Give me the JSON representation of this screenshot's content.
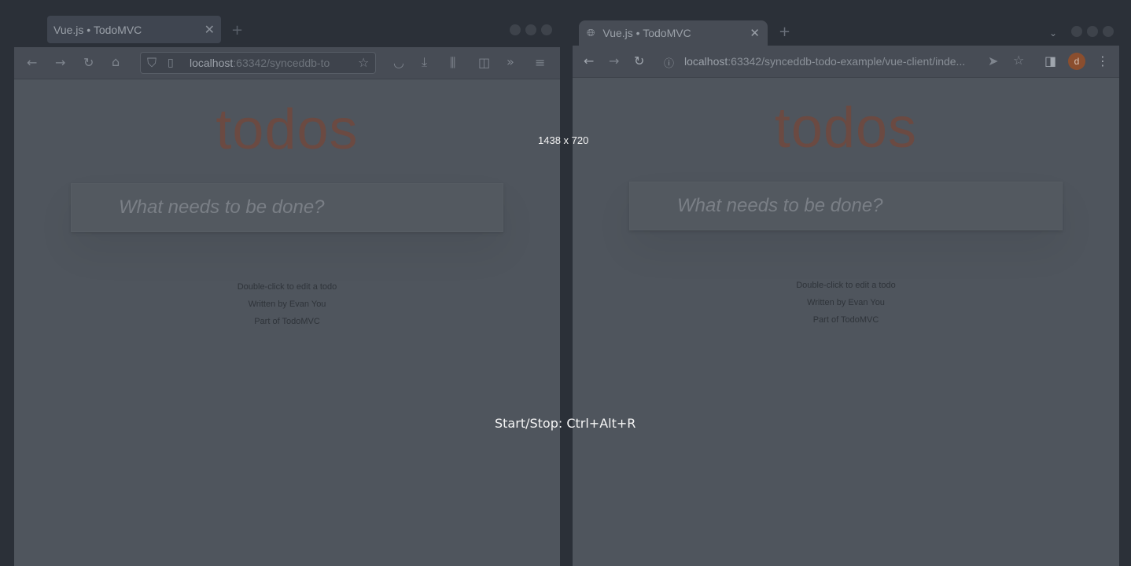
{
  "overlay": {
    "size_label": "1438 x 720",
    "hint": "Start/Stop: Ctrl+Alt+R"
  },
  "left_browser": {
    "tab_title": "Vue.js • TodoMVC",
    "url_host": "localhost",
    "url_rest": ":63342/synceddb-to",
    "icons": [
      "back-icon",
      "forward-icon",
      "reload-icon",
      "home-icon",
      "shield-icon",
      "page-icon",
      "star-icon",
      "pocket-icon",
      "download-icon",
      "library-icon",
      "sidebar-icon",
      "overflow-icon",
      "menu-icon"
    ]
  },
  "right_browser": {
    "tab_title": "Vue.js • TodoMVC",
    "url_host": "localhost",
    "url_rest": ":63342/synceddb-todo-example/vue-client/inde...",
    "avatar_letter": "d",
    "icons": [
      "back-icon",
      "forward-icon",
      "reload-icon",
      "info-icon",
      "send-icon",
      "star-icon",
      "side-panel-icon",
      "kebab-menu-icon"
    ]
  },
  "app": {
    "title": "todos",
    "input_placeholder": "What needs to be done?",
    "footer": {
      "line1": "Double-click to edit a todo",
      "line2": "Written by Evan You",
      "line3": "Part of TodoMVC"
    }
  },
  "colors": {
    "desktop": "#2b3038",
    "page_dimmed": "#4f555d",
    "title": "#6b4a42",
    "avatar": "#8b4e2e"
  }
}
